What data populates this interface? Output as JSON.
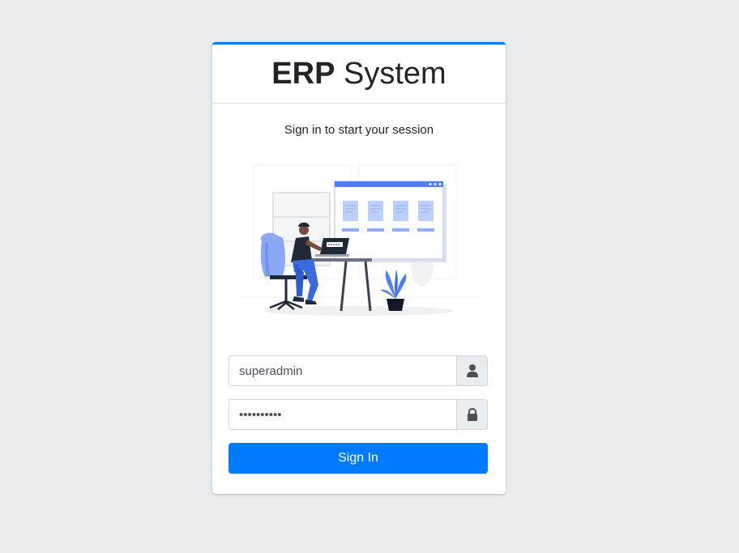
{
  "brand": {
    "bold": "ERP",
    "light": "System"
  },
  "login_message": "Sign in to start your session",
  "username": {
    "value": "superadmin",
    "icon": "user-icon"
  },
  "password": {
    "value": "superadmin",
    "icon": "lock-icon"
  },
  "sign_in_label": "Sign In",
  "colors": {
    "accent": "#007bff",
    "background": "#e9ecef",
    "illustration_blue": "#4f7ef5"
  }
}
